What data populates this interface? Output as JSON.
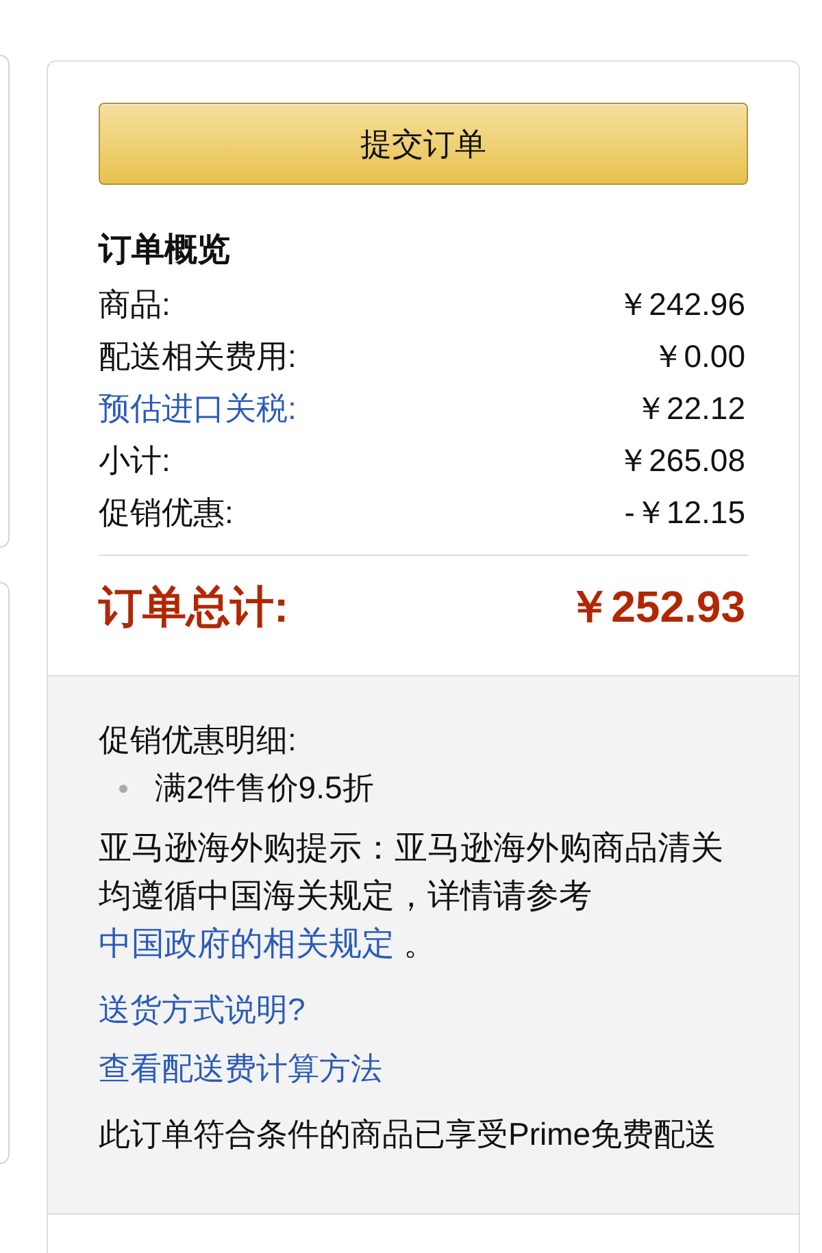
{
  "submit_button": {
    "label": "提交订单"
  },
  "order_summary": {
    "title": "订单概览",
    "rows": [
      {
        "kind": "plain",
        "label": "商品:",
        "value": "￥242.96"
      },
      {
        "kind": "plain",
        "label": "配送相关费用:",
        "value": "￥0.00"
      },
      {
        "kind": "link",
        "label": "预估进口关税:",
        "value": "￥22.12"
      },
      {
        "kind": "plain",
        "label": "小计:",
        "value": "￥265.08"
      },
      {
        "kind": "plain",
        "label": "促销优惠:",
        "value": "-￥12.15"
      }
    ],
    "total": {
      "label": "订单总计:",
      "value": "￥252.93"
    }
  },
  "details": {
    "promotions": {
      "title": "促销优惠明细:",
      "items": [
        "满2件售价9.5折"
      ]
    },
    "notice": {
      "text": "亚马逊海外购提示：亚马逊海外购商品清关均遵循中国海关规定，详情请参考",
      "link": "中国政府的相关规定",
      "end": "。"
    },
    "links": [
      "送货方式说明?",
      "查看配送费计算方法"
    ],
    "prime_note": "此订单符合条件的商品已享受Prime免费配送"
  }
}
